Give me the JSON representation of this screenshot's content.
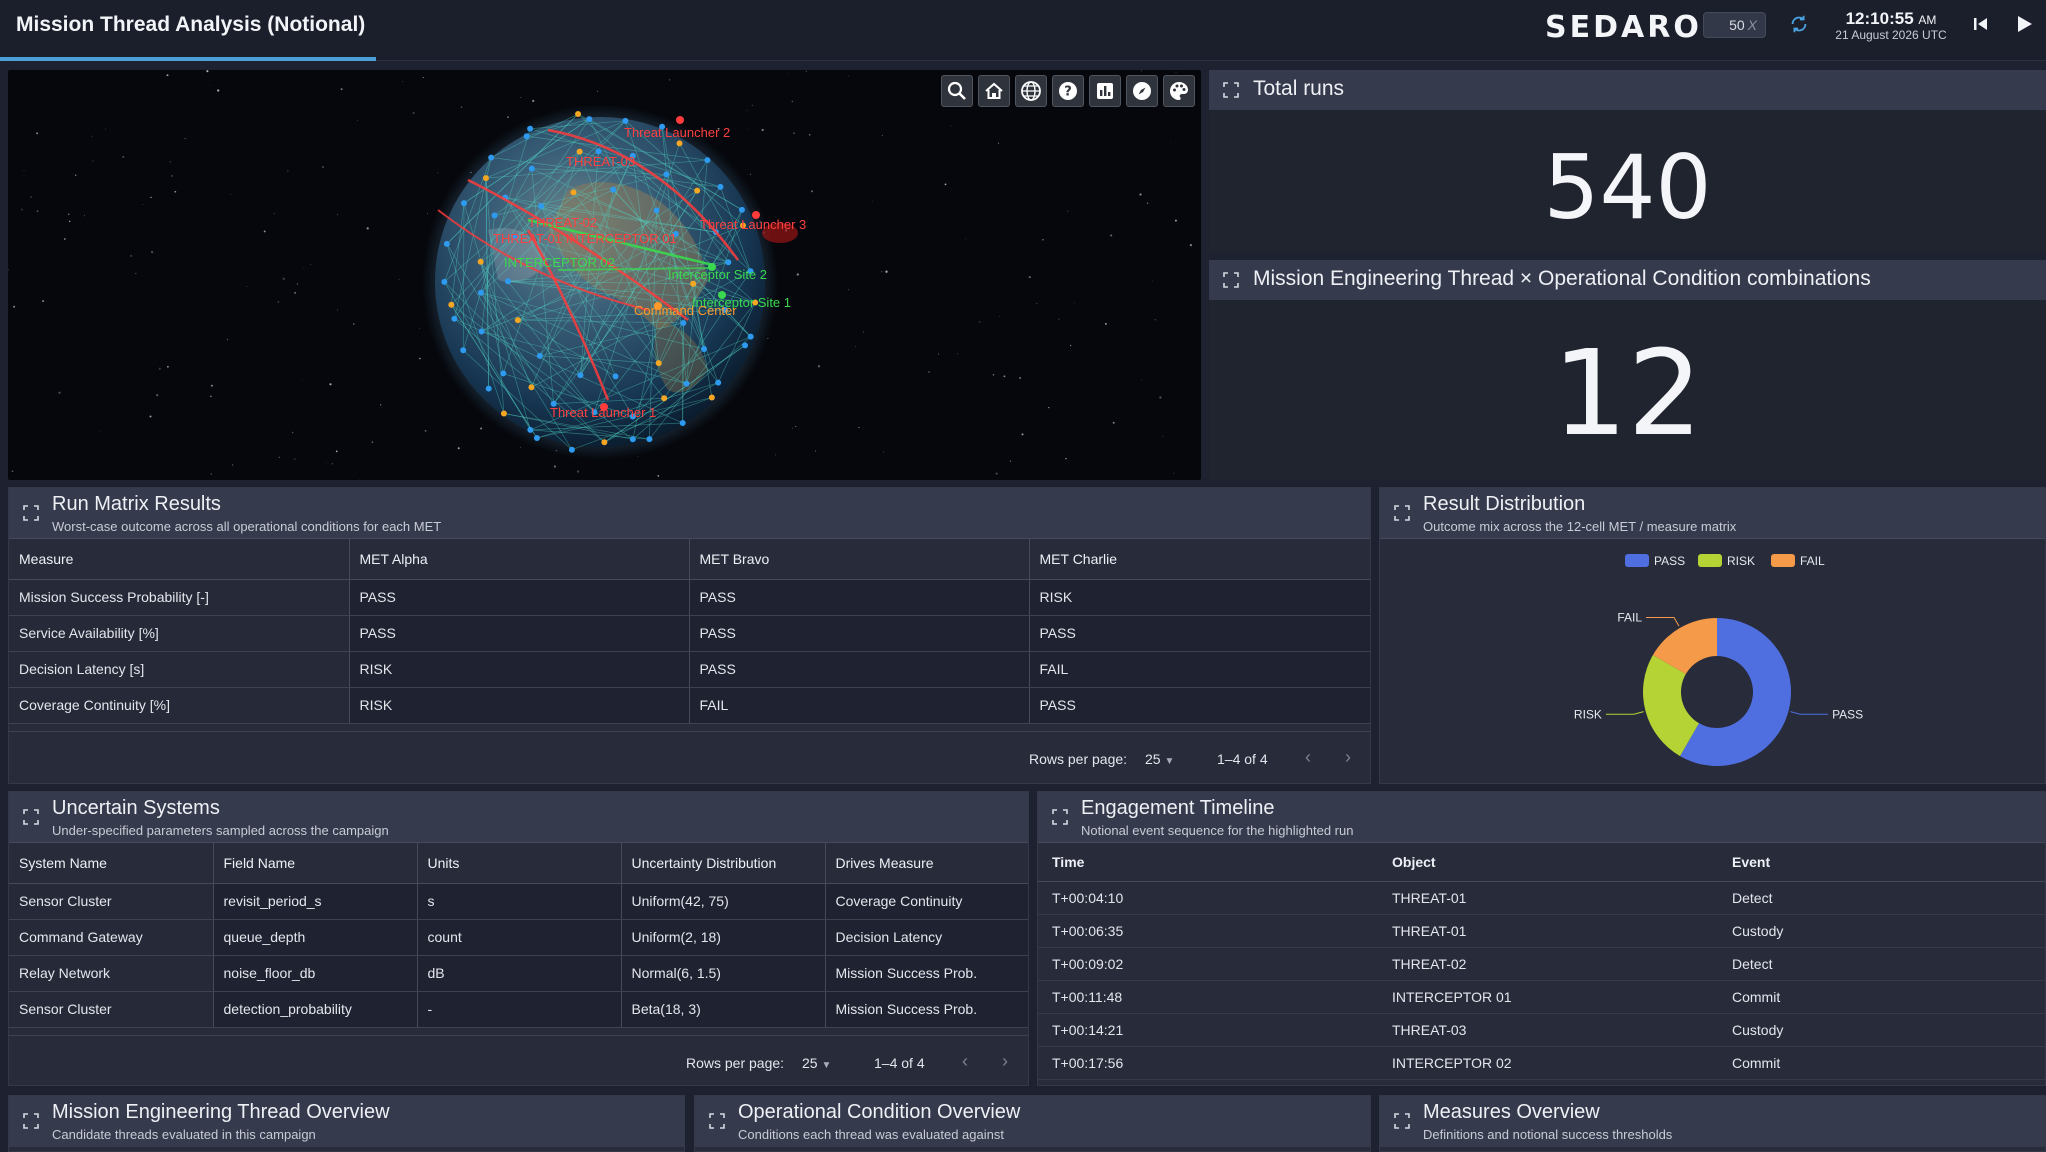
{
  "header": {
    "title": "Mission Thread Analysis (Notional)",
    "logo": "SEDARO",
    "speed_value": "50",
    "speed_unit": "X",
    "clock_time": "12:10:55",
    "clock_ampm": "AM",
    "clock_date": "21 August 2026 UTC"
  },
  "globe": {
    "toolbar": [
      "search-icon",
      "home-icon",
      "globe-icon",
      "help-icon",
      "chart-icon",
      "compass-icon",
      "palette-icon"
    ],
    "labels": {
      "threat_launcher_2": "Threat Launcher 2",
      "threat_03": "THREAT-03",
      "threat_launcher_3": "Threat Launcher 3",
      "threat_02": "THREAT-02",
      "threat_01_interceptor_01": "THREAT-01 INTERCEPTOR 01",
      "interceptor_02": "INTERCEPTOR 02",
      "interceptor_site_2": "Interceptor Site 2",
      "interceptor_site_1": "Interceptor Site 1",
      "command_center": "Command Center",
      "threat_launcher_1": "Threat Launcher 1"
    },
    "colors": {
      "threat": "#ff3838",
      "interceptor": "#36d94c",
      "command": "#ff9a2a",
      "sat_blue": "#2e9bf0",
      "sat_orange": "#f5a623"
    }
  },
  "kpi_total": {
    "title": "Total runs",
    "value": "540"
  },
  "kpi_combos": {
    "title": "Mission Engineering Thread × Operational Condition combinations",
    "value": "12"
  },
  "run_matrix": {
    "title": "Run Matrix Results",
    "subtitle": "Worst-case outcome across all operational conditions for each MET",
    "columns": [
      "Measure",
      "MET Alpha",
      "MET Bravo",
      "MET Charlie"
    ],
    "rows": [
      {
        "measure": "Mission Success Probability [-]",
        "alpha": "PASS",
        "bravo": "PASS",
        "charlie": "RISK"
      },
      {
        "measure": "Service Availability [%]",
        "alpha": "PASS",
        "bravo": "PASS",
        "charlie": "PASS"
      },
      {
        "measure": "Decision Latency [s]",
        "alpha": "RISK",
        "bravo": "PASS",
        "charlie": "FAIL"
      },
      {
        "measure": "Coverage Continuity [%]",
        "alpha": "RISK",
        "bravo": "FAIL",
        "charlie": "PASS"
      }
    ],
    "pager": {
      "rows_label": "Rows per page:",
      "rows_value": "25",
      "range": "1–4 of 4"
    }
  },
  "result_distribution": {
    "title": "Result Distribution",
    "subtitle": "Outcome mix across the 12-cell MET / measure matrix",
    "legend": [
      "PASS",
      "RISK",
      "FAIL"
    ],
    "callouts": {
      "pass": "PASS",
      "risk": "RISK",
      "fail": "FAIL"
    }
  },
  "chart_data": {
    "type": "pie",
    "categories": [
      "PASS",
      "RISK",
      "FAIL"
    ],
    "values": [
      7,
      3,
      2
    ],
    "colors": [
      "#4f6fe0",
      "#b5d334",
      "#f59a48"
    ],
    "donut": true,
    "legend_position": "top"
  },
  "uncertain_systems": {
    "title": "Uncertain Systems",
    "subtitle": "Under-specified parameters sampled across the campaign",
    "columns": [
      "System Name",
      "Field Name",
      "Units",
      "Uncertainty Distribution",
      "Drives Measure"
    ],
    "rows": [
      {
        "system": "Sensor Cluster",
        "field": "revisit_period_s",
        "units": "s",
        "dist": "Uniform(42, 75)",
        "drives": "Coverage Continuity"
      },
      {
        "system": "Command Gateway",
        "field": "queue_depth",
        "units": "count",
        "dist": "Uniform(2, 18)",
        "drives": "Decision Latency"
      },
      {
        "system": "Relay Network",
        "field": "noise_floor_db",
        "units": "dB",
        "dist": "Normal(6, 1.5)",
        "drives": "Mission Success Prob."
      },
      {
        "system": "Sensor Cluster",
        "field": "detection_probability",
        "units": "-",
        "dist": "Beta(18, 3)",
        "drives": "Mission Success Prob."
      }
    ],
    "pager": {
      "rows_label": "Rows per page:",
      "rows_value": "25",
      "range": "1–4 of 4"
    }
  },
  "timeline": {
    "title": "Engagement Timeline",
    "subtitle": "Notional event sequence for the highlighted run",
    "columns": [
      "Time",
      "Object",
      "Event"
    ],
    "rows": [
      {
        "time": "T+00:04:10",
        "object": "THREAT-01",
        "event": "Detect"
      },
      {
        "time": "T+00:06:35",
        "object": "THREAT-01",
        "event": "Custody"
      },
      {
        "time": "T+00:09:02",
        "object": "THREAT-02",
        "event": "Detect"
      },
      {
        "time": "T+00:11:48",
        "object": "INTERCEPTOR 01",
        "event": "Commit"
      },
      {
        "time": "T+00:14:21",
        "object": "THREAT-03",
        "event": "Custody"
      },
      {
        "time": "T+00:17:56",
        "object": "INTERCEPTOR 02",
        "event": "Commit"
      }
    ]
  },
  "met_overview": {
    "title": "Mission Engineering Thread Overview",
    "subtitle": "Candidate threads evaluated in this campaign"
  },
  "oc_overview": {
    "title": "Operational Condition Overview",
    "subtitle": "Conditions each thread was evaluated against"
  },
  "measures_overview": {
    "title": "Measures Overview",
    "subtitle": "Definitions and notional success thresholds"
  }
}
